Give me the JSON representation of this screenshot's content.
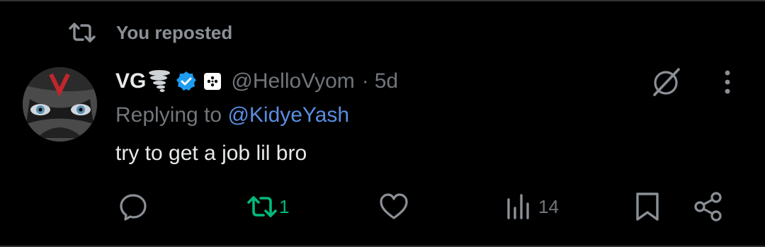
{
  "repost_banner": {
    "label": "You reposted"
  },
  "post": {
    "display_name": "VG",
    "handle": "@HelloVyom",
    "separator": "·",
    "time": "5d",
    "reply_prefix": "Replying to ",
    "reply_to": "@KidyeYash",
    "text": "try to get a job lil bro"
  },
  "actions": {
    "reply_count": "",
    "repost_count": "1",
    "like_count": "",
    "views_count": "14"
  },
  "colors": {
    "background": "#000000",
    "muted": "#71767b",
    "mention": "#5b8ee0",
    "repost_active": "#00ba7c",
    "verified": "#1d9bf0"
  },
  "icons": {
    "repost": "repost-icon",
    "verified": "verified-badge-icon",
    "grok": "grok-icon",
    "more": "more-icon",
    "reply": "reply-icon",
    "like": "heart-icon",
    "views": "views-icon",
    "bookmark": "bookmark-icon",
    "share": "share-icon"
  }
}
